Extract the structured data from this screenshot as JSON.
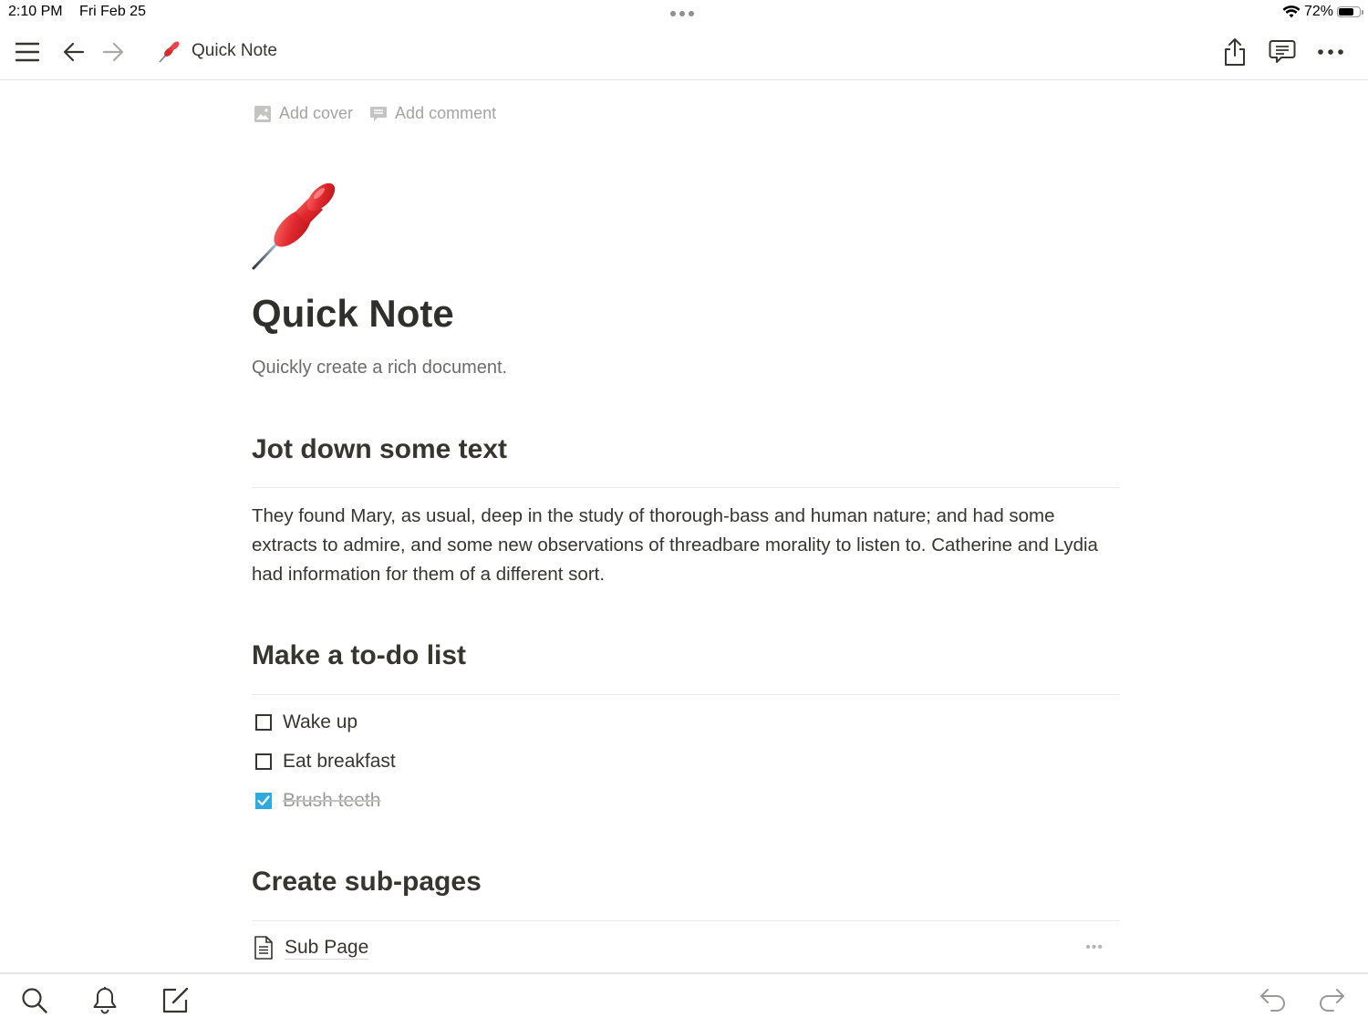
{
  "status_bar": {
    "time": "2:10 PM",
    "date": "Fri Feb 25",
    "battery_percent_label": "72%",
    "battery_level": 0.72
  },
  "top_bar": {
    "breadcrumb_icon": "pushpin-emoji",
    "breadcrumb_title": "Quick Note",
    "icons": [
      "menu-icon",
      "back-arrow-icon",
      "forward-arrow-icon",
      "share-icon",
      "comment-icon",
      "more-icon"
    ]
  },
  "page": {
    "actions": {
      "add_cover": "Add cover",
      "add_comment": "Add comment"
    },
    "icon": "pushpin-emoji",
    "title": "Quick Note",
    "subtitle": "Quickly create a rich document.",
    "sections": {
      "text": {
        "heading": "Jot down some text",
        "paragraph": "They found Mary, as usual, deep in the study of thorough-bass and human nature; and had some extracts to admire, and some new observations of threadbare morality to listen to. Catherine and Lydia had information for them of a different sort."
      },
      "todo": {
        "heading": "Make a to-do list",
        "items": [
          {
            "label": "Wake up",
            "checked": false
          },
          {
            "label": "Eat breakfast",
            "checked": false
          },
          {
            "label": "Brush teeth",
            "checked": true
          }
        ]
      },
      "subpages": {
        "heading": "Create sub-pages",
        "items": [
          {
            "label": "Sub Page",
            "more": "•••"
          }
        ]
      }
    }
  },
  "colors": {
    "checkbox_checked": "#2eaadc",
    "accent_red": "#e0282e"
  },
  "bottom_bar": {
    "icons": [
      "search-icon",
      "bell-icon",
      "new-page-icon",
      "undo-icon",
      "redo-icon"
    ]
  }
}
